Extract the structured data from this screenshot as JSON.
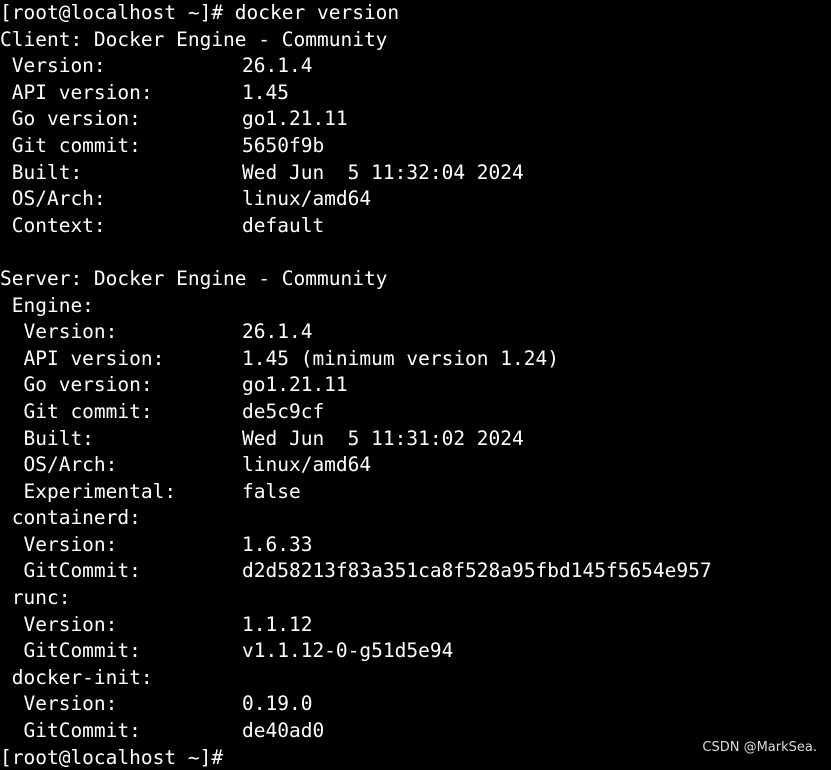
{
  "prompt_command": "[root@localhost ~]# docker version",
  "client_header": "Client: Docker Engine - Community",
  "client": [
    {
      "key": " Version:",
      "value": "26.1.4"
    },
    {
      "key": " API version:",
      "value": "1.45"
    },
    {
      "key": " Go version:",
      "value": "go1.21.11"
    },
    {
      "key": " Git commit:",
      "value": "5650f9b"
    },
    {
      "key": " Built:",
      "value": "Wed Jun  5 11:32:04 2024"
    },
    {
      "key": " OS/Arch:",
      "value": "linux/amd64"
    },
    {
      "key": " Context:",
      "value": "default"
    }
  ],
  "server_header": "Server: Docker Engine - Community",
  "engine_header": " Engine:",
  "engine": [
    {
      "key": "  Version:",
      "value": "26.1.4"
    },
    {
      "key": "  API version:",
      "value": "1.45 (minimum version 1.24)"
    },
    {
      "key": "  Go version:",
      "value": "go1.21.11"
    },
    {
      "key": "  Git commit:",
      "value": "de5c9cf"
    },
    {
      "key": "  Built:",
      "value": "Wed Jun  5 11:31:02 2024"
    },
    {
      "key": "  OS/Arch:",
      "value": "linux/amd64"
    },
    {
      "key": "  Experimental:",
      "value": "false"
    }
  ],
  "containerd_header": " containerd:",
  "containerd": [
    {
      "key": "  Version:",
      "value": "1.6.33"
    },
    {
      "key": "  GitCommit:",
      "value": "d2d58213f83a351ca8f528a95fbd145f5654e957"
    }
  ],
  "runc_header": " runc:",
  "runc": [
    {
      "key": "  Version:",
      "value": "1.1.12"
    },
    {
      "key": "  GitCommit:",
      "value": "v1.1.12-0-g51d5e94"
    }
  ],
  "dockerinit_header": " docker-init:",
  "dockerinit": [
    {
      "key": "  Version:",
      "value": "0.19.0"
    },
    {
      "key": "  GitCommit:",
      "value": "de40ad0"
    }
  ],
  "prompt_end": "[root@localhost ~]#",
  "watermark": "CSDN @MarkSea."
}
